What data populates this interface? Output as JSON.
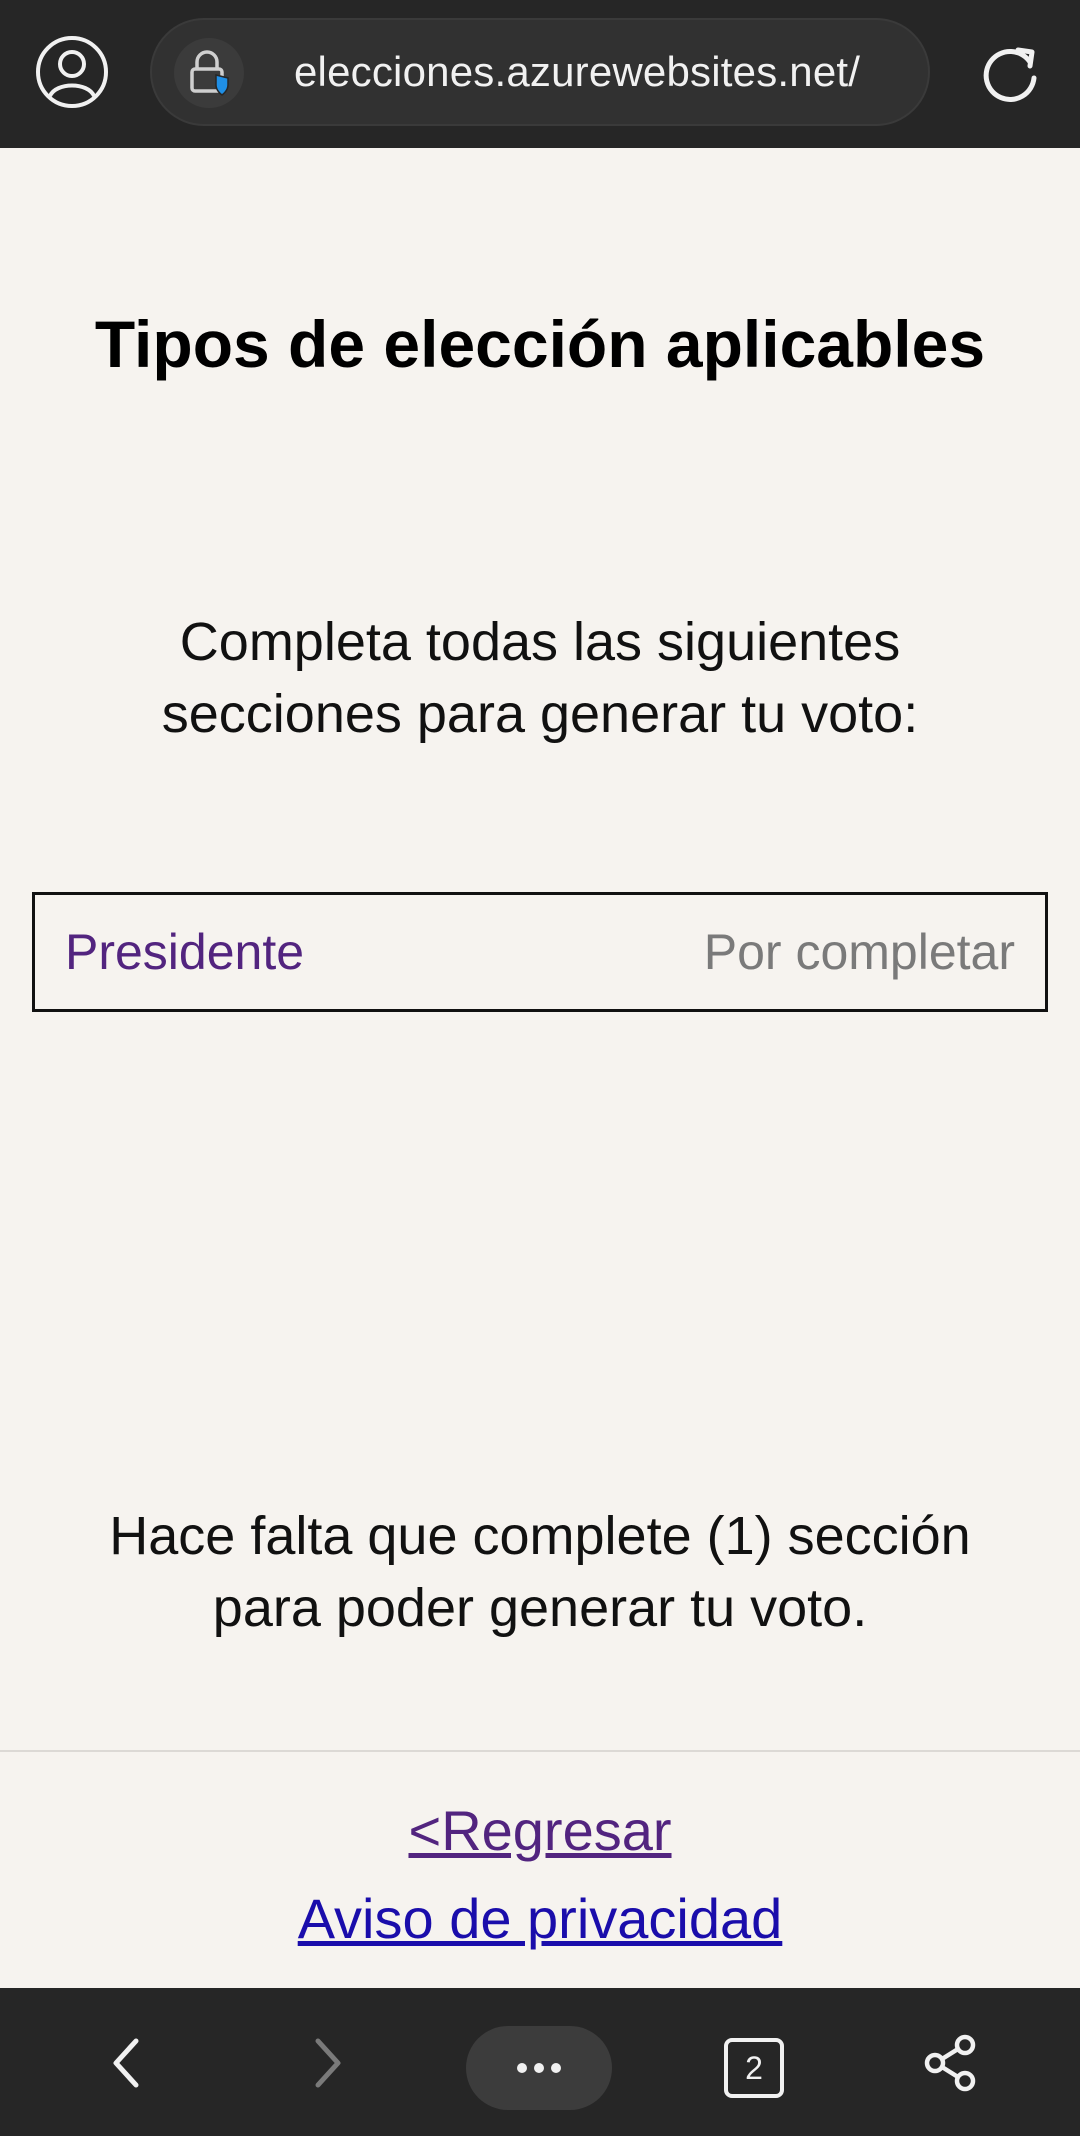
{
  "browser": {
    "url": "elecciones.azurewebsites.net/",
    "tab_count": "2",
    "colors": {
      "toolbar_bg": "#262626",
      "url_text": "#f1f1f1",
      "security_badge": "#1f8fe6"
    },
    "icons": {
      "profile": "profile-icon",
      "lock": "lock-shield-icon",
      "reload": "reload-icon",
      "back": "back-arrow-icon",
      "forward": "forward-arrow-icon",
      "menu": "more-dots-icon",
      "tabs": "tabs-icon",
      "share": "share-icon"
    }
  },
  "page": {
    "title": "Tipos de elección aplicables",
    "instructions_line1": "Completa todas las siguientes",
    "instructions_line2": "secciones para generar tu voto:",
    "sections": [
      {
        "name": "Presidente",
        "status": "Por completar"
      }
    ],
    "missing_line1": "Hace falta que complete (1) sección",
    "missing_line2": "para poder generar tu voto.",
    "links": {
      "back": "<Regresar",
      "privacy": "Aviso de privacidad"
    },
    "colors": {
      "background": "#f6f3ef",
      "section_name": "#52247f",
      "section_status": "#7a7a7a",
      "link_back": "#52247f",
      "link_privacy": "#1a0dab"
    }
  }
}
